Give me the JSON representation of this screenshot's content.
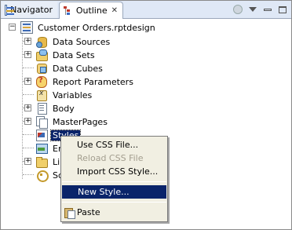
{
  "tabs": [
    {
      "label": "Navigator",
      "icon": "navigator-icon",
      "active": false
    },
    {
      "label": "Outline",
      "icon": "outline-icon",
      "active": true,
      "closable": true
    }
  ],
  "toolbar": {
    "icons": [
      "gear-icon",
      "view-menu-icon",
      "minimize-icon",
      "maximize-icon"
    ]
  },
  "tree": {
    "root": {
      "label": "Customer Orders.rptdesign",
      "icon": "report-design-icon",
      "expanded": true
    },
    "children": [
      {
        "label": "Data Sources",
        "icon": "data-sources-icon",
        "expandable": true
      },
      {
        "label": "Data Sets",
        "icon": "data-sets-icon",
        "expandable": true
      },
      {
        "label": "Data Cubes",
        "icon": "data-cubes-icon",
        "expandable": false
      },
      {
        "label": "Report Parameters",
        "icon": "report-parameters-icon",
        "expandable": true
      },
      {
        "label": "Variables",
        "icon": "variables-icon",
        "expandable": false
      },
      {
        "label": "Body",
        "icon": "body-icon",
        "expandable": true
      },
      {
        "label": "MasterPages",
        "icon": "master-pages-icon",
        "expandable": true
      },
      {
        "label": "Styles",
        "icon": "styles-icon",
        "expandable": false,
        "selected": true
      },
      {
        "label": "Em",
        "icon": "embedded-images-icon",
        "expandable": false
      },
      {
        "label": "Lib",
        "icon": "libraries-icon",
        "expandable": true
      },
      {
        "label": "Sc",
        "icon": "scripts-icon",
        "expandable": false
      }
    ]
  },
  "context_menu": {
    "items": [
      {
        "label": "Use CSS File...",
        "enabled": true
      },
      {
        "label": "Reload CSS File",
        "enabled": false
      },
      {
        "label": "Import CSS Style...",
        "enabled": true
      },
      {
        "separator": true
      },
      {
        "label": "New Style...",
        "enabled": true,
        "highlighted": true
      },
      {
        "separator": true
      },
      {
        "label": "Paste",
        "enabled": true,
        "icon": "paste-icon"
      }
    ]
  },
  "colors": {
    "selection": "#0a246a",
    "menu_background": "#f1efe2",
    "tab_header": "#dfe8f6"
  }
}
